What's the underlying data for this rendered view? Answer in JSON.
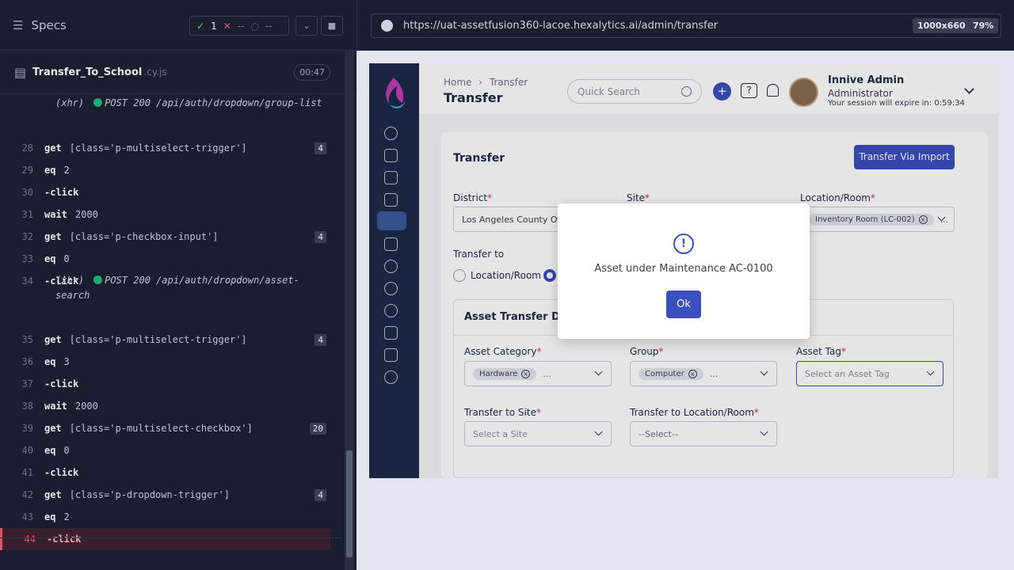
{
  "runner": {
    "specs_label": "Specs",
    "passed": "1",
    "failed": "--",
    "pending": "--",
    "file_name": "Transfer_To_School",
    "file_ext": ".cy.js",
    "duration": "00:47"
  },
  "commands": [
    {
      "type": "xhr",
      "text": "(xhr)",
      "req": "POST 200 /api/auth/dropdown/group-list"
    },
    {
      "num": "28",
      "cmd": "get",
      "arg": "[class='p-multiselect-trigger']",
      "badge": "4"
    },
    {
      "num": "29",
      "cmd": "eq",
      "arg": "2"
    },
    {
      "num": "30",
      "cmd": "-click",
      "arg": ""
    },
    {
      "num": "31",
      "cmd": "wait",
      "arg": "2000"
    },
    {
      "num": "32",
      "cmd": "get",
      "arg": "[class='p-checkbox-input']",
      "badge": "4"
    },
    {
      "num": "33",
      "cmd": "eq",
      "arg": "0"
    },
    {
      "num": "34",
      "cmd": "-click",
      "arg": ""
    },
    {
      "type": "xhr",
      "text": "(xhr)",
      "req": "POST 200 /api/auth/dropdown/asset-",
      "req2": "search"
    },
    {
      "num": "35",
      "cmd": "get",
      "arg": "[class='p-multiselect-trigger']",
      "badge": "4"
    },
    {
      "num": "36",
      "cmd": "eq",
      "arg": "3"
    },
    {
      "num": "37",
      "cmd": "-click",
      "arg": ""
    },
    {
      "num": "38",
      "cmd": "wait",
      "arg": "2000"
    },
    {
      "num": "39",
      "cmd": "get",
      "arg": "[class='p-multiselect-checkbox']",
      "badge": "20"
    },
    {
      "num": "40",
      "cmd": "eq",
      "arg": "0"
    },
    {
      "num": "41",
      "cmd": "-click",
      "arg": ""
    },
    {
      "num": "42",
      "cmd": "get",
      "arg": "[class='p-dropdown-trigger']",
      "badge": "4"
    },
    {
      "num": "43",
      "cmd": "eq",
      "arg": "2"
    },
    {
      "num": "44",
      "cmd": "-click",
      "arg": ""
    }
  ],
  "browser": {
    "url": "https://uat-assetfusion360-lacoe.hexalytics.ai/admin/transfer",
    "viewport": "1000x660",
    "zoom": "79%"
  },
  "app": {
    "breadcrumb_home": "Home",
    "breadcrumb_sep": "›",
    "breadcrumb_current": "Transfer",
    "page_title": "Transfer",
    "search_placeholder": "Quick Search",
    "plus": "+",
    "help": "?",
    "user_name": "Innive Admin",
    "user_role": "Administrator",
    "session": "Your session will expire in: 0:59:34",
    "card_title": "Transfer",
    "import_button": "Transfer Via Import",
    "district_label": "District",
    "district_value": "Los Angeles County Offic",
    "site_label": "Site",
    "location_label": "Location/Room",
    "location_chip": "Inventory Room (LC-002)",
    "transfer_to_label": "Transfer to",
    "radio_location": "Location/Room",
    "section_title": "Asset Transfer Deta",
    "asset_category_label": "Asset Category",
    "asset_category_chip": "Hardware",
    "group_label": "Group",
    "group_chip": "Computer",
    "asset_tag_label": "Asset Tag",
    "asset_tag_placeholder": "Select an Asset Tag",
    "transfer_site_label": "Transfer to Site",
    "transfer_site_placeholder": "Select a Site",
    "transfer_loc_label": "Transfer to Location/Room",
    "transfer_loc_placeholder": "--Select--",
    "asterisk": "*",
    "chip_x": "×",
    "ellipsis": "..."
  },
  "modal": {
    "icon": "!",
    "message": "Asset under Maintenance AC-0100",
    "ok": "Ok"
  }
}
